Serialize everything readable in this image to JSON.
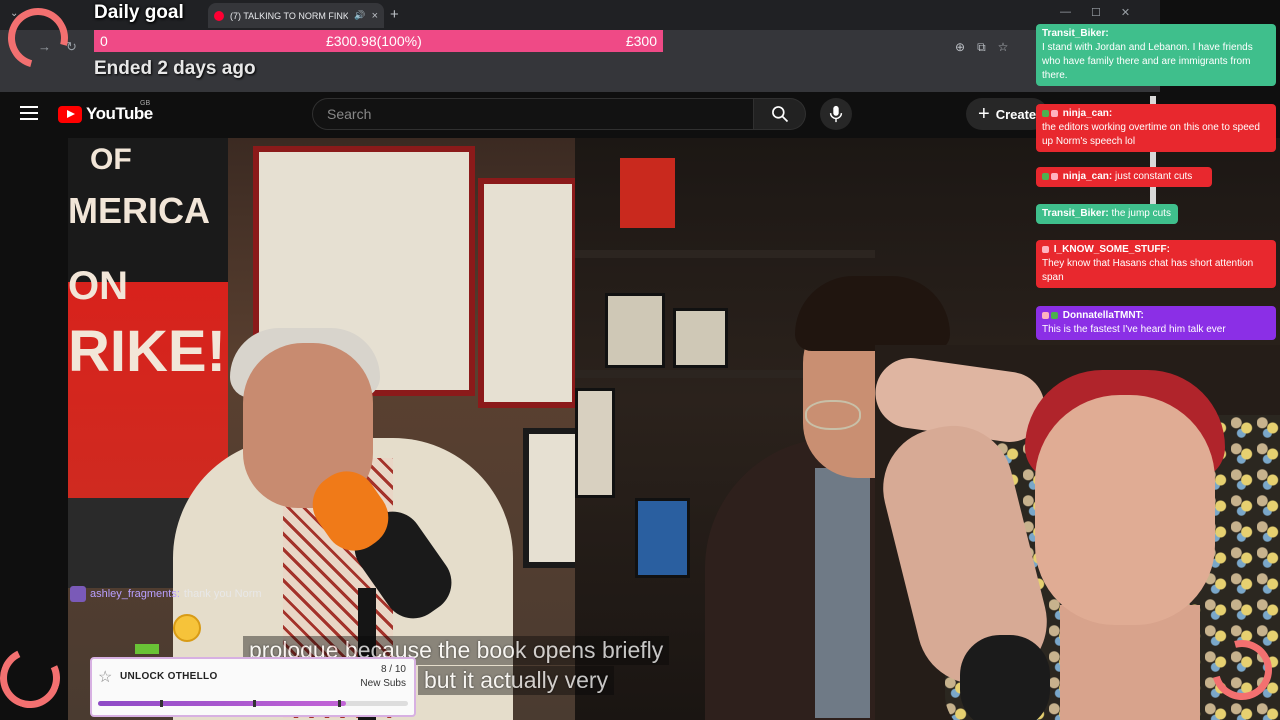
{
  "browser": {
    "tab_title": "(7) TALKING TO NORM FINK",
    "tab_audio_icon": "speaker-icon",
    "tab_close": "×",
    "new_tab": "+",
    "win_minimize": "—",
    "win_maximize": "☐",
    "win_close": "✕"
  },
  "goal": {
    "title": "Daily goal",
    "start": "0",
    "current": "£300.98(100%)",
    "target": "£300",
    "status": "Ended 2 days ago",
    "progress_percent": 100,
    "bar_color": "#ef4a86"
  },
  "youtube": {
    "logo_text": "YouTube",
    "region": "GB",
    "search_placeholder": "Search",
    "create_label": "Create",
    "brand_color": "#ff0000"
  },
  "video": {
    "sign_lines": [
      "OF",
      "MERICA",
      "ON",
      "RIKE!"
    ],
    "subtitle_line1": "prologue because the book opens briefly",
    "subtitle_line2": "but it actually very"
  },
  "video_chat": {
    "user": "ashley_fragments:",
    "text": "thank you Norm"
  },
  "unlock_widget": {
    "title": "UNLOCK OTHELLO",
    "count": "8 / 10",
    "subtitle": "New Subs",
    "progress": 0.8
  },
  "chat": [
    {
      "user": "Transit_Biker:",
      "text": "I stand with Jordan and Lebanon. I have friends who have family there and are immigrants from there.",
      "color": "#3fbf8c"
    },
    {
      "user": "ninja_can:",
      "text": "the editors working overtime on this one to speed up Norm's speech lol",
      "color": "#e8282e"
    },
    {
      "user": "ninja_can:",
      "text": "just constant cuts",
      "color": "#e8282e"
    },
    {
      "user": "Transit_Biker:",
      "text": "the jump cuts",
      "color": "#3fbf8c"
    },
    {
      "user": "I_KNOW_SOME_STUFF:",
      "text": "They know that Hasans chat has short attention span",
      "color": "#e8282e"
    },
    {
      "user": "DonnatellaTMNT:",
      "text": "This is the fastest I've heard him talk ever",
      "color": "#8b2fe6"
    }
  ]
}
